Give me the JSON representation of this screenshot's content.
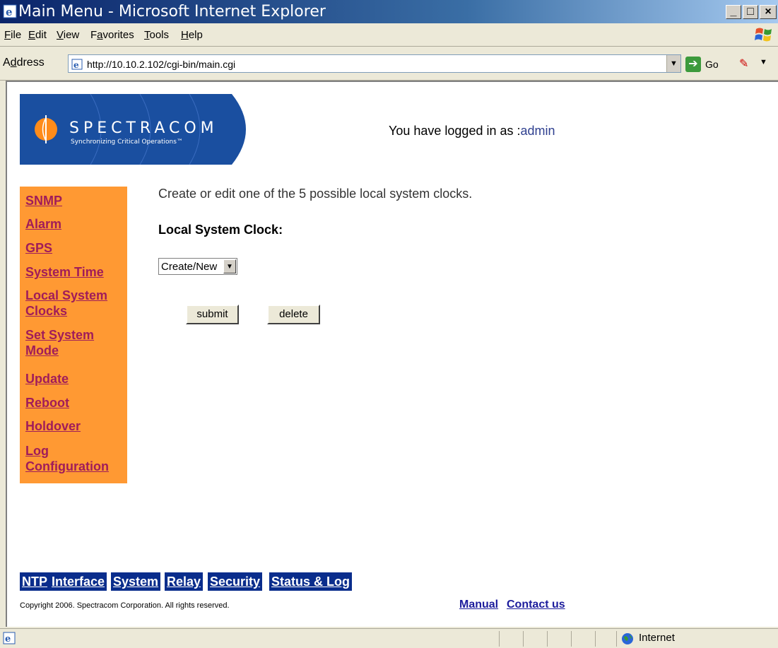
{
  "window": {
    "title": "Main Menu - Microsoft Internet Explorer",
    "controls": {
      "minimize": "_",
      "maximize": "□",
      "close": "×"
    }
  },
  "menubar": {
    "items": [
      {
        "pre": "",
        "key": "F",
        "post": "ile"
      },
      {
        "pre": "",
        "key": "E",
        "post": "dit"
      },
      {
        "pre": "",
        "key": "V",
        "post": "iew"
      },
      {
        "pre": "F",
        "key": "a",
        "post": "vorites"
      },
      {
        "pre": "",
        "key": "T",
        "post": "ools"
      },
      {
        "pre": "",
        "key": "H",
        "post": "elp"
      }
    ]
  },
  "addressbar": {
    "label_pre": "A",
    "label_key": "d",
    "label_post": "dress",
    "url": "http://10.10.2.102/cgi-bin/main.cgi",
    "go_label": "Go"
  },
  "header": {
    "login_prefix": "You have logged in as :",
    "username": "admin"
  },
  "logo": {
    "brand": "SPECTRACOM",
    "tagline": "Synchronizing Critical Operations™",
    "color": "#1a4fa0",
    "accent": "#ff8c1a"
  },
  "sidenav": {
    "color": "#ff9933",
    "items": [
      {
        "label": "SNMP"
      },
      {
        "label": "Alarm"
      },
      {
        "label": "GPS"
      },
      {
        "label": "System Time"
      },
      {
        "label": "Local System"
      },
      {
        "label": "Clocks"
      },
      {
        "label": "Set System"
      },
      {
        "label": "Mode"
      },
      {
        "label": "Update"
      },
      {
        "label": "Reboot"
      },
      {
        "label": "Holdover"
      },
      {
        "label": "Log"
      },
      {
        "label": "Configuration"
      }
    ]
  },
  "main": {
    "intro": "Create or edit one of the 5 possible local system clocks.",
    "field_label": "Local System Clock:",
    "select_value": "Create/New",
    "submit_label": "submit",
    "delete_label": "delete"
  },
  "bottom_tabs": {
    "color": "#0a2d8c",
    "items": [
      "NTP",
      "Interface",
      "System",
      "Relay",
      "Security",
      "Status & Log"
    ]
  },
  "footer": {
    "copyright": "Copyright 2006. Spectracom Corporation. All rights reserved.",
    "manual": "Manual",
    "contact": "Contact us"
  },
  "statusbar": {
    "zone": "Internet"
  }
}
